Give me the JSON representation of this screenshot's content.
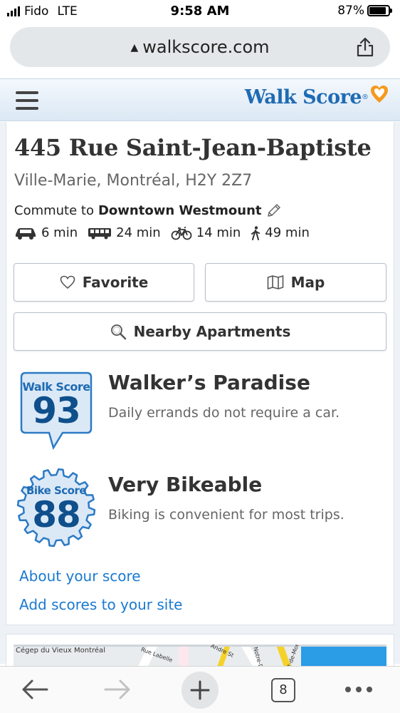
{
  "status_bar": {
    "carrier": "Fido",
    "network": "LTE",
    "time": "9:58 AM",
    "battery": "87%",
    "battery_level": 0.87
  },
  "browser": {
    "url": "walkscore.com",
    "lock_icon": "lock-icon",
    "share_icon": "share-icon"
  },
  "site_header": {
    "logo_text": "Walk Score",
    "logo_reg": "®",
    "accent": "#1f6bb3",
    "heart_color": "#f59a1e"
  },
  "property": {
    "address": "445 Rue Saint-Jean-Baptiste",
    "city": "Ville-Marie, Montréal, H2Y 2Z7",
    "commute_prefix": "Commute to",
    "commute_destination": "Downtown Westmount",
    "modes": [
      {
        "icon": "car-icon",
        "value": "6 min"
      },
      {
        "icon": "bus-icon",
        "value": "24 min"
      },
      {
        "icon": "bike-icon",
        "value": "14 min"
      },
      {
        "icon": "walk-icon",
        "value": "49 min"
      }
    ]
  },
  "buttons": {
    "favorite": "Favorite",
    "map": "Map",
    "nearby": "Nearby Apartments"
  },
  "scores": {
    "walk": {
      "badge_title": "Walk Score",
      "value": "93",
      "heading": "Walker’s Paradise",
      "description": "Daily errands do not require a car."
    },
    "bike": {
      "badge_title": "Bike Score",
      "value": "88",
      "heading": "Very Bikeable",
      "description": "Biking is convenient for most trips."
    }
  },
  "links": {
    "about": "About your score",
    "add": "Add scores to your site"
  },
  "map_preview": {
    "labels": [
      "Cégep du Vieux Montréal",
      "Rue Labelle",
      "Andre St",
      "Notre-D",
      "ot-de-Mon"
    ]
  },
  "toolbar": {
    "tabs_count": "8"
  }
}
